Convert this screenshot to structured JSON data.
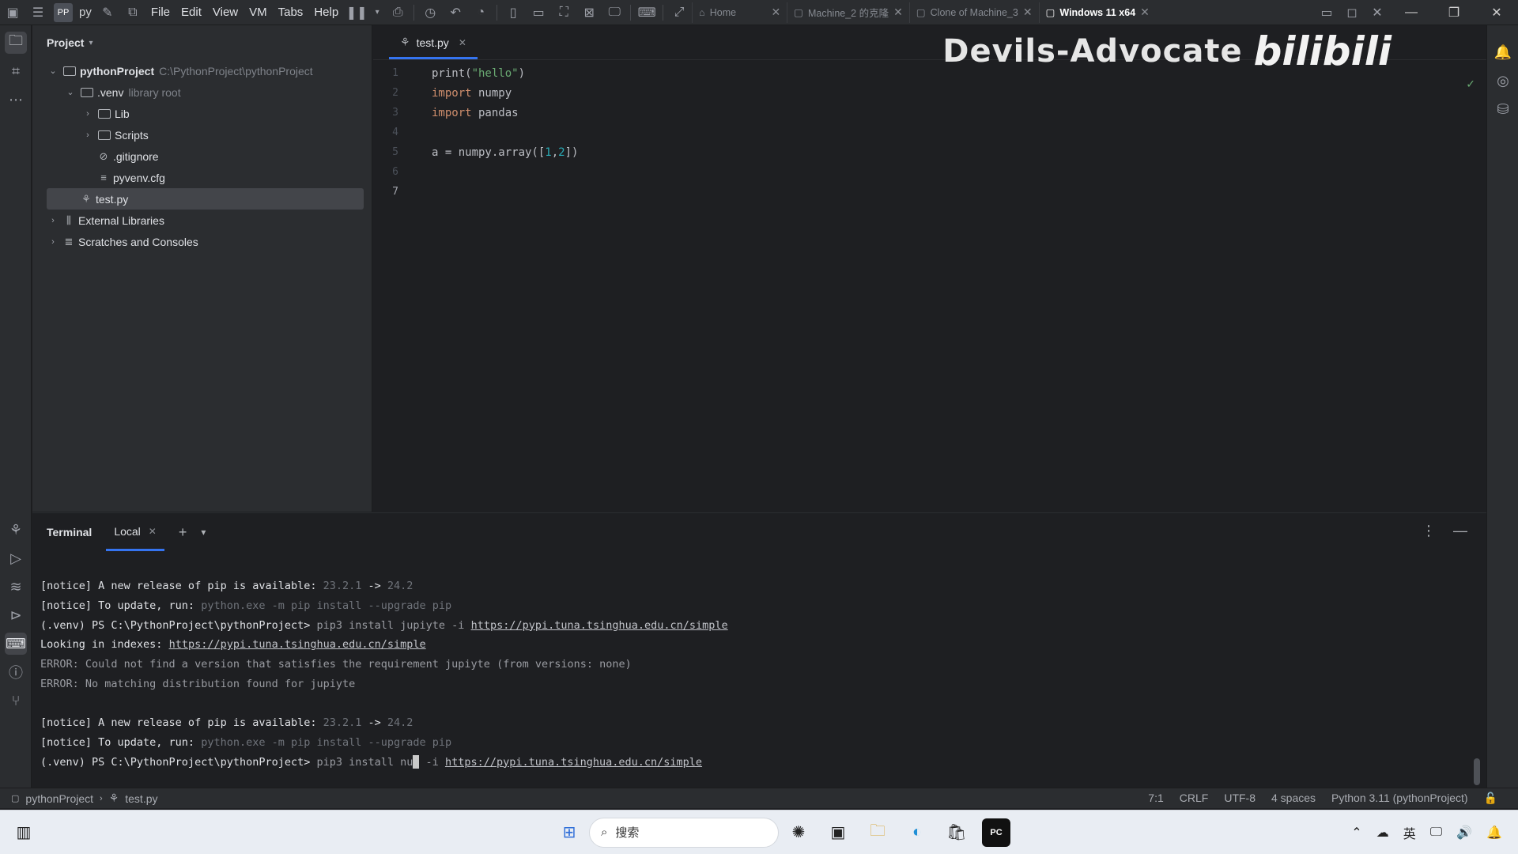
{
  "vm": {
    "menus": [
      "File",
      "Edit",
      "View",
      "VM",
      "Tabs",
      "Help"
    ],
    "pp_label": "py",
    "tabs": [
      {
        "label": "Home",
        "active": false
      },
      {
        "label": "Machine_2 的克隆",
        "active": false
      },
      {
        "label": "Clone of Machine_3",
        "active": false
      },
      {
        "label": "Windows 11 x64",
        "active": true
      }
    ]
  },
  "watermark": {
    "text": "Devils-Advocate",
    "logo": "bilibili"
  },
  "project": {
    "header": "Project",
    "tree": [
      {
        "label": "pythonProject",
        "hint": "C:\\PythonProject\\pythonProject",
        "indent": 0,
        "chevron": "v",
        "icon": "folder",
        "bold": true
      },
      {
        "label": ".venv",
        "hint": "library root",
        "indent": 1,
        "chevron": "v",
        "icon": "folder",
        "bold": false
      },
      {
        "label": "Lib",
        "hint": "",
        "indent": 2,
        "chevron": ">",
        "icon": "folder",
        "bold": false
      },
      {
        "label": "Scripts",
        "hint": "",
        "indent": 2,
        "chevron": ">",
        "icon": "folder",
        "bold": false
      },
      {
        "label": ".gitignore",
        "hint": "",
        "indent": 2,
        "chevron": "",
        "icon": "ignore",
        "bold": false
      },
      {
        "label": "pyvenv.cfg",
        "hint": "",
        "indent": 2,
        "chevron": "",
        "icon": "text",
        "bold": false
      },
      {
        "label": "test.py",
        "hint": "",
        "indent": 1,
        "chevron": "",
        "icon": "python",
        "bold": false,
        "selected": true
      },
      {
        "label": "External Libraries",
        "hint": "",
        "indent": 0,
        "chevron": ">",
        "icon": "library",
        "bold": false
      },
      {
        "label": "Scratches and Consoles",
        "hint": "",
        "indent": 0,
        "chevron": ">",
        "icon": "scratch",
        "bold": false
      }
    ]
  },
  "editor": {
    "tab_label": "test.py",
    "lines": [
      {
        "n": "1",
        "tokens": [
          {
            "t": "print(",
            "c": "fn"
          },
          {
            "t": "\"hello\"",
            "c": "str"
          },
          {
            "t": ")",
            "c": "fn"
          }
        ]
      },
      {
        "n": "2",
        "tokens": [
          {
            "t": "import",
            "c": "kw"
          },
          {
            "t": " numpy",
            "c": "fn"
          }
        ]
      },
      {
        "n": "3",
        "tokens": [
          {
            "t": "import",
            "c": "kw"
          },
          {
            "t": " pandas",
            "c": "fn"
          }
        ]
      },
      {
        "n": "4",
        "tokens": []
      },
      {
        "n": "5",
        "tokens": [
          {
            "t": "a = numpy.array([",
            "c": "fn"
          },
          {
            "t": "1",
            "c": "num"
          },
          {
            "t": ",",
            "c": "fn"
          },
          {
            "t": "2",
            "c": "num"
          },
          {
            "t": "])",
            "c": "fn"
          }
        ]
      },
      {
        "n": "6",
        "tokens": []
      },
      {
        "n": "7",
        "tokens": [],
        "current": true
      }
    ]
  },
  "terminal": {
    "title": "Terminal",
    "tab_label": "Local",
    "lines": [
      [
        {
          "t": "[notice] A new release of pip is available: ",
          "c": ""
        },
        {
          "t": "23.2.1",
          "c": "dim"
        },
        {
          "t": " -> ",
          "c": ""
        },
        {
          "t": "24.2",
          "c": "dim"
        }
      ],
      [
        {
          "t": "[notice] To update, run: ",
          "c": ""
        },
        {
          "t": "python.exe -m pip install --upgrade pip",
          "c": "dim"
        }
      ],
      [
        {
          "t": "(.venv) PS C:\\PythonProject\\pythonProject> ",
          "c": ""
        },
        {
          "t": "pip3 install jupiyte -i ",
          "c": "err"
        },
        {
          "t": "https://pypi.tuna.tsinghua.edu.cn/simple",
          "c": "link"
        }
      ],
      [
        {
          "t": "Looking in indexes: ",
          "c": ""
        },
        {
          "t": "https://pypi.tuna.tsinghua.edu.cn/simple",
          "c": "link"
        }
      ],
      [
        {
          "t": "ERROR: Could not find a version that satisfies the requirement jupiyte (from versions: none)",
          "c": "err"
        }
      ],
      [
        {
          "t": "ERROR: No matching distribution found for jupiyte",
          "c": "err"
        }
      ],
      [],
      [
        {
          "t": "[notice] A new release of pip is available: ",
          "c": ""
        },
        {
          "t": "23.2.1",
          "c": "dim"
        },
        {
          "t": " -> ",
          "c": ""
        },
        {
          "t": "24.2",
          "c": "dim"
        }
      ],
      [
        {
          "t": "[notice] To update, run: ",
          "c": ""
        },
        {
          "t": "python.exe -m pip install --upgrade pip",
          "c": "dim"
        }
      ],
      [
        {
          "t": "(.venv) PS C:\\PythonProject\\pythonProject> ",
          "c": ""
        },
        {
          "t": "pip3 install nu",
          "c": "err"
        },
        {
          "t": "CURSOR",
          "c": "cursor"
        },
        {
          "t": " -i ",
          "c": "err"
        },
        {
          "t": "https://pypi.tuna.tsinghua.edu.cn/simple",
          "c": "link"
        }
      ]
    ]
  },
  "status": {
    "crumb_project": "pythonProject",
    "crumb_file": "test.py",
    "position": "7:1",
    "line_sep": "CRLF",
    "encoding": "UTF-8",
    "indent": "4 spaces",
    "interpreter": "Python 3.11 (pythonProject)"
  },
  "taskbar": {
    "search_placeholder": "搜索",
    "tray_lang": "英"
  }
}
